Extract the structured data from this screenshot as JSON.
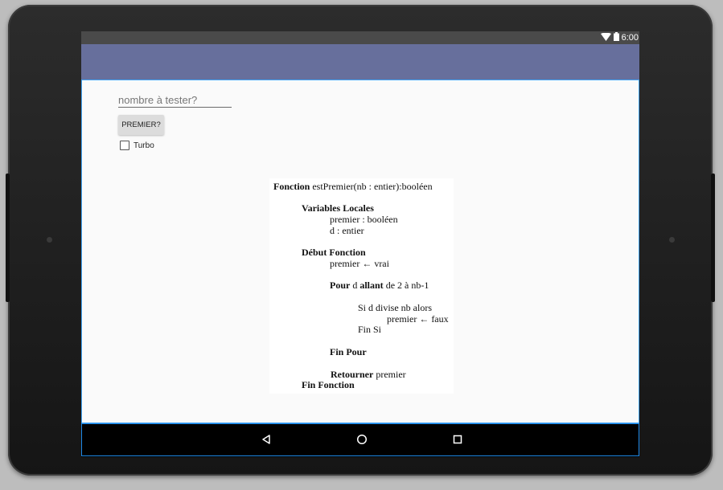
{
  "status_bar": {
    "time": "6:00",
    "icons": [
      "wifi-icon",
      "battery-icon"
    ]
  },
  "form": {
    "number_input": {
      "placeholder": "nombre à tester?",
      "value": ""
    },
    "premier_button": "PREMIER?",
    "turbo_checkbox": {
      "label": "Turbo",
      "checked": false
    }
  },
  "algorithm": {
    "header_keyword": "Fonction",
    "header_signature": "estPremier(nb : entier):booléen",
    "variables_heading": "Variables Locales",
    "var_premier": "premier : booléen",
    "var_d": "d : entier",
    "debut_heading": "Début Fonction",
    "assign_true": "premier ←  vrai",
    "for_kw_pour": "Pour",
    "for_var": "d",
    "for_kw_allant": "allant",
    "for_range": "de 2 à nb-1",
    "if_line": "Si d divise nb alors",
    "assign_false": "premier ← faux",
    "endif_line": "Fin Si",
    "end_for": "Fin Pour",
    "return_kw": "Retourner",
    "return_val": "premier",
    "end_function": "Fin Fonction"
  },
  "nav_bar": {
    "buttons": [
      "back-icon",
      "home-icon",
      "recents-icon"
    ]
  },
  "colors": {
    "app_bar": "#676f9c",
    "status_bar": "#4a4a4a",
    "accent_border": "#42a5f5"
  }
}
